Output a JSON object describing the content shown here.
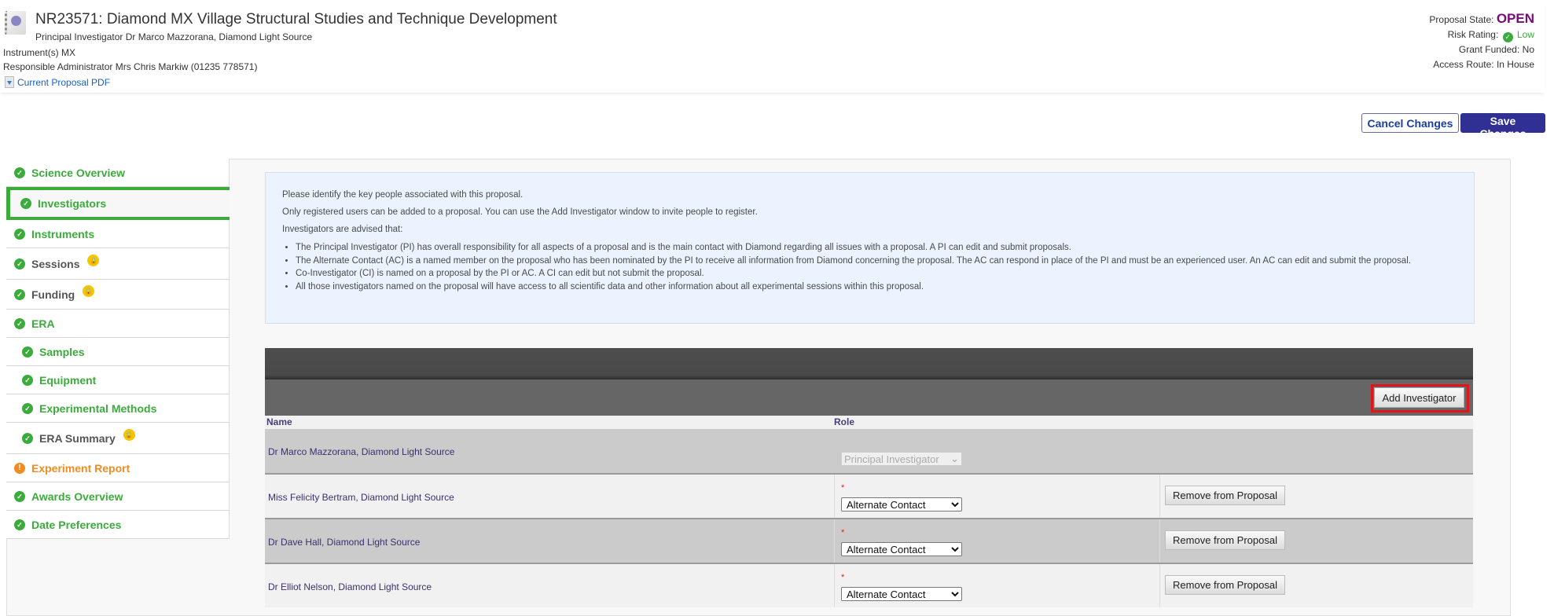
{
  "header": {
    "title": "NR23571: Diamond MX Village Structural Studies and Technique Development",
    "pi_line": "Principal Investigator Dr Marco Mazzorana, Diamond Light Source",
    "instruments_line": "Instrument(s) MX",
    "admin_line": "Responsible Administrator Mrs Chris Markiw (01235 778571)",
    "pdf_link": "Current Proposal PDF",
    "proposal_state_label": "Proposal State:",
    "proposal_state_value": "OPEN",
    "risk_label": "Risk Rating:",
    "risk_value": "Low",
    "grant_label": "Grant Funded:",
    "grant_value": "No",
    "access_label": "Access Route:",
    "access_value": "In House"
  },
  "actions": {
    "cancel_label": "Cancel Changes",
    "save_label": "Save Changes"
  },
  "sidebar": {
    "items": [
      {
        "label": "Science Overview",
        "status": "complete"
      },
      {
        "label": "Investigators",
        "status": "complete",
        "active": true
      },
      {
        "label": "Instruments",
        "status": "complete"
      },
      {
        "label": "Sessions",
        "status": "complete",
        "locked": true
      },
      {
        "label": "Funding",
        "status": "complete",
        "locked": true
      },
      {
        "label": "ERA",
        "status": "complete"
      },
      {
        "label": "Samples",
        "status": "complete",
        "sub": true
      },
      {
        "label": "Equipment",
        "status": "complete",
        "sub": true
      },
      {
        "label": "Experimental Methods",
        "status": "complete",
        "sub": true
      },
      {
        "label": "ERA Summary",
        "status": "complete",
        "sub": true,
        "locked": true
      },
      {
        "label": "Experiment Report",
        "status": "warning"
      },
      {
        "label": "Awards Overview",
        "status": "complete"
      },
      {
        "label": "Date Preferences",
        "status": "complete"
      }
    ]
  },
  "info": {
    "p1": "Please identify the key people associated with this proposal.",
    "p2": "Only registered users can be added to a proposal. You can use the Add Investigator window to invite people to register.",
    "p3": "Investigators are advised that:",
    "bullets": [
      "The Principal Investigator (PI) has overall responsibility for all aspects of a proposal and is the main contact with Diamond regarding all issues with a proposal. A PI can edit and submit proposals.",
      "The Alternate Contact (AC) is a named member on the proposal who has been nominated by the PI to receive all information from Diamond concerning the proposal. The AC can respond in place of the PI and must be an experienced user. An AC can edit and submit the proposal.",
      "Co-Investigator (CI) is named on a proposal by the PI or AC. A CI can edit but not submit the proposal.",
      "All those investigators named on the proposal will have access to all scientific data and other information about all experimental sessions within this proposal."
    ]
  },
  "grid": {
    "add_label": "Add Investigator",
    "col_name": "Name",
    "col_role": "Role",
    "required_mark": "*",
    "remove_label": "Remove from Proposal",
    "rows": [
      {
        "name": "Dr Marco Mazzorana, Diamond Light Source",
        "role": "Principal Investigator"
      },
      {
        "name": "Miss Felicity Bertram, Diamond Light Source",
        "role": "Alternate Contact"
      },
      {
        "name": "Dr Dave Hall, Diamond Light Source",
        "role": "Alternate Contact"
      },
      {
        "name": "Dr Elliot Nelson, Diamond Light Source",
        "role": "Alternate Contact"
      }
    ]
  },
  "icons": {
    "check": "✓",
    "exclamation": "!",
    "lock": "🔒",
    "chevron": "⌄"
  },
  "colors": {
    "accent_green": "#3bab3b",
    "warning_orange": "#f08c22",
    "state_purple": "#7a0a7a",
    "save_blue": "#2f2f94",
    "highlight_red": "#e0161b"
  }
}
